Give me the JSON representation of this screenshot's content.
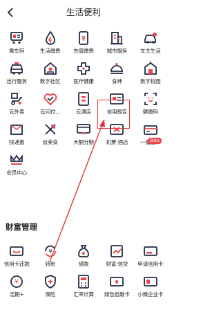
{
  "header": {
    "title": "生活便利"
  },
  "colors": {
    "accent": "#e2343a",
    "icon_dark": "#1f2a44",
    "icon_red": "#e8454d",
    "icon_light_red": "#fde2e3"
  },
  "life_services": [
    {
      "label": "乘车码",
      "icon": "bus-card-icon"
    },
    {
      "label": "生活缴费",
      "icon": "water-drop-icon"
    },
    {
      "label": "充值缴费",
      "icon": "phone-topup-icon"
    },
    {
      "label": "城市服务",
      "icon": "city-building-icon"
    },
    {
      "label": "车主生活",
      "icon": "car-icon"
    },
    {
      "label": "出行服务",
      "icon": "taxi-icon"
    },
    {
      "label": "数字社区",
      "icon": "home-icon"
    },
    {
      "label": "医疗健康",
      "icon": "medical-cross-icon"
    },
    {
      "label": "食神",
      "icon": "dish-cover-icon"
    },
    {
      "label": "数字校园",
      "icon": "school-icon"
    },
    {
      "label": "云外卖",
      "icon": "delivery-scooter-icon"
    },
    {
      "label": "云闪付...",
      "icon": "heart-icon"
    },
    {
      "label": "云酒店",
      "icon": "hotel-icon"
    },
    {
      "label": "信用报告",
      "icon": "credit-report-icon"
    },
    {
      "label": "健康码",
      "icon": "health-code-icon"
    },
    {
      "label": "快递惠",
      "icon": "parcel-icon"
    },
    {
      "label": "云美食",
      "icon": "cutlery-icon"
    },
    {
      "label": "大额分期",
      "icon": "installment-card-icon"
    },
    {
      "label": "机票·酒店",
      "icon": "plane-ticket-icon"
    },
    {
      "label": "一键查卡",
      "icon": "card-search-icon"
    },
    {
      "label": "会员中心",
      "icon": "crown-icon"
    }
  ],
  "beta_badge": "Beta",
  "wealth": {
    "title": "财富管理",
    "items": [
      {
        "label": "信用卡还款",
        "icon": "credit-card-icon"
      },
      {
        "label": "转账",
        "icon": "transfer-yuan-icon"
      },
      {
        "label": "借款",
        "icon": "money-bag-icon"
      },
      {
        "label": "财富·信贷",
        "icon": "wealth-chart-icon"
      },
      {
        "label": "申请信用卡",
        "icon": "apply-card-icon"
      },
      {
        "label": "活期+",
        "icon": "current-deposit-icon"
      },
      {
        "label": "保险",
        "icon": "shield-plus-icon"
      },
      {
        "label": "汇率计算",
        "icon": "calculator-icon"
      },
      {
        "label": "绿色低碳卡",
        "icon": "green-card-icon"
      },
      {
        "label": "小微企业卡",
        "icon": "business-card-icon"
      }
    ]
  }
}
